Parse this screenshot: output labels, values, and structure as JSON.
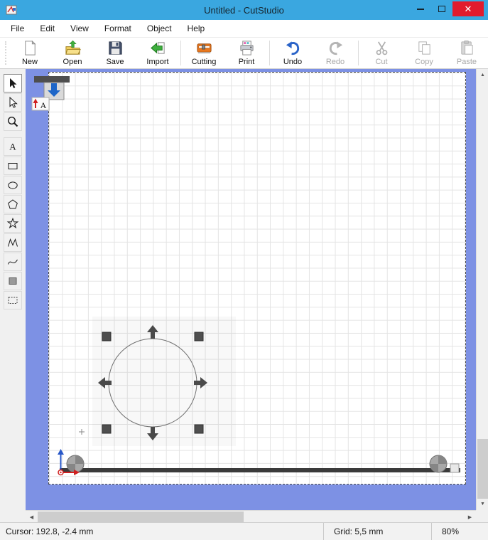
{
  "colors": {
    "titlebar": "#3aa7e0",
    "close_button": "#e11b2d",
    "canvas_background": "#7d91e4",
    "page_background": "#ffffff",
    "undo_arrow": "#2a63c8",
    "import_arrow": "#3fae3f",
    "cutting_icon": "#e87820",
    "origin_x_axis": "#d02020",
    "origin_y_axis": "#2757c8",
    "selection_handle": "#4f4f4f"
  },
  "titlebar": {
    "title": "Untitled - CutStudio"
  },
  "icons": {
    "close": "✕",
    "scroll_up": "▲",
    "scroll_down": "▼",
    "scroll_left": "◀",
    "scroll_right": "▶"
  },
  "menu": {
    "items": [
      "File",
      "Edit",
      "View",
      "Format",
      "Object",
      "Help"
    ]
  },
  "toolbar": {
    "buttons": [
      {
        "label": "New",
        "enabled": true
      },
      {
        "label": "Open",
        "enabled": true
      },
      {
        "label": "Save",
        "enabled": true
      },
      {
        "label": "Import",
        "enabled": true
      },
      {
        "label": "Cutting",
        "enabled": true
      },
      {
        "label": "Print",
        "enabled": true
      },
      {
        "label": "Undo",
        "enabled": true
      },
      {
        "label": "Redo",
        "enabled": false
      },
      {
        "label": "Cut",
        "enabled": false
      },
      {
        "label": "Copy",
        "enabled": false
      },
      {
        "label": "Paste",
        "enabled": false
      }
    ]
  },
  "toolbox": {
    "tools": [
      "select",
      "edit-points",
      "zoom",
      "text",
      "rectangle",
      "ellipse",
      "polygon",
      "star",
      "polyline",
      "curve",
      "image",
      "select-area"
    ],
    "active_tool": "select",
    "text_tool_glyph": "A"
  },
  "canvas": {
    "selected_object": "circle",
    "load_marker_letter": "A"
  },
  "statusbar": {
    "cursor": "Cursor: 192.8, -2.4 mm",
    "grid": "Grid: 5,5 mm",
    "zoom": "80%"
  }
}
